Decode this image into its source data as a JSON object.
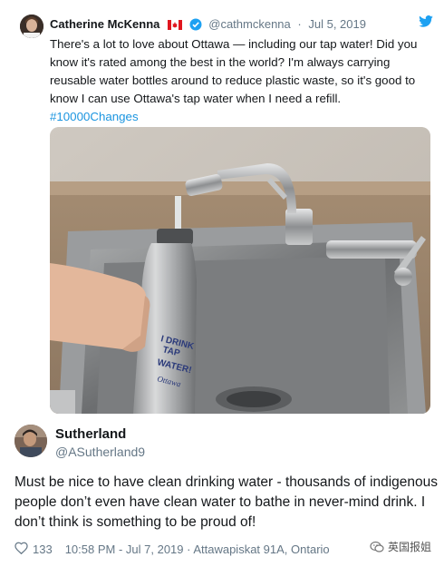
{
  "tweet": {
    "author_name": "Catherine McKenna",
    "handle": "@cathmckenna",
    "separator": "·",
    "date": "Jul 5, 2019",
    "text": "There's a lot to love about Ottawa — including our tap water! Did you know it's rated among the best in the world? I'm always carrying reusable water bottles around to reduce plastic waste, so it's good to know I can use Ottawa's tap water when I need a refill.",
    "hashtag": "#10000Changes",
    "bottle_text_line1": "I DRINK",
    "bottle_text_line2": "TAP",
    "bottle_text_line3": "WATER!",
    "bottle_text_line4": "Ottawa"
  },
  "reply": {
    "author_name": "Sutherland",
    "handle": "@ASutherland9",
    "text": "Must be nice to have clean drinking water - thousands of indigenous people don’t even have clean water to bathe in never-mind drink. I don’t think is something to be proud of!",
    "likes": "133",
    "timestamp": "10:58 PM - Jul 7, 2019 · Attawapiskat 91A, Ontario"
  },
  "watermark": {
    "text": "英国报姐"
  },
  "colors": {
    "link": "#1b95e0",
    "secondary_text": "#657786",
    "primary_text": "#14171a",
    "verified_blue": "#1da1f2",
    "flag_red": "#e0161e"
  },
  "icons": [
    "canada-flag-icon",
    "verified-badge-icon",
    "twitter-bird-icon",
    "heart-icon",
    "wechat-icon"
  ]
}
